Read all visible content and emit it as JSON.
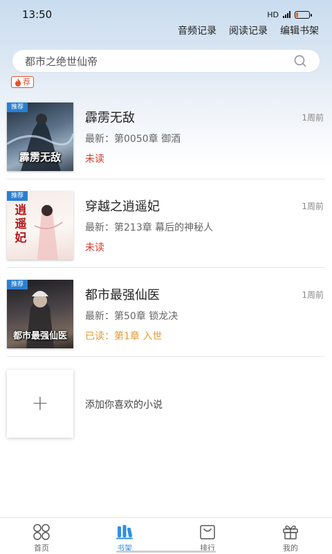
{
  "status_bar": {
    "time": "13:50",
    "network": "HD"
  },
  "top_links": [
    {
      "label": "音频记录"
    },
    {
      "label": "阅读记录"
    },
    {
      "label": "编辑书架"
    }
  ],
  "search": {
    "text": "都市之绝世仙帝",
    "icon": "search-icon"
  },
  "recommend_badge": {
    "label": "荐",
    "icon": "fire-icon"
  },
  "books": [
    {
      "title": "霹雳无敌",
      "time": "1周前",
      "latest": "最新：第0050章 御酒",
      "status": "未读",
      "status_type": "unread",
      "cover_tag": "推荐",
      "cover_title": "霹雳无敌",
      "cover_colors": [
        "#3a4a5c",
        "#7f93a7"
      ]
    },
    {
      "title": "穿越之逍遥妃",
      "time": "1周前",
      "latest": "最新：第213章 幕后的神秘人",
      "status": "未读",
      "status_type": "unread",
      "cover_tag": "推荐",
      "cover_title": "逍遥妃",
      "cover_colors": [
        "#f3e2df",
        "#fbf6f3"
      ]
    },
    {
      "title": "都市最强仙医",
      "time": "1周前",
      "latest": "最新：第50章 锁龙决",
      "status": "已读：第1章 入世",
      "status_type": "read",
      "cover_tag": "推荐",
      "cover_title": "都市最强仙医",
      "cover_colors": [
        "#2a2a2e",
        "#6b5a4c"
      ]
    }
  ],
  "add_item": {
    "label": "添加你喜欢的小说",
    "icon": "plus-icon"
  },
  "bottom_nav": [
    {
      "label": "首页",
      "icon": "home-grid-icon",
      "active": false
    },
    {
      "label": "书架",
      "icon": "bookshelf-icon",
      "active": true
    },
    {
      "label": "排行",
      "icon": "ranking-bag-icon",
      "active": false
    },
    {
      "label": "我的",
      "icon": "gift-icon",
      "active": false
    }
  ],
  "colors": {
    "accent": "#2f8fe0",
    "unread": "#d23c2c",
    "read": "#e39a35",
    "badge": "#e8502f"
  }
}
